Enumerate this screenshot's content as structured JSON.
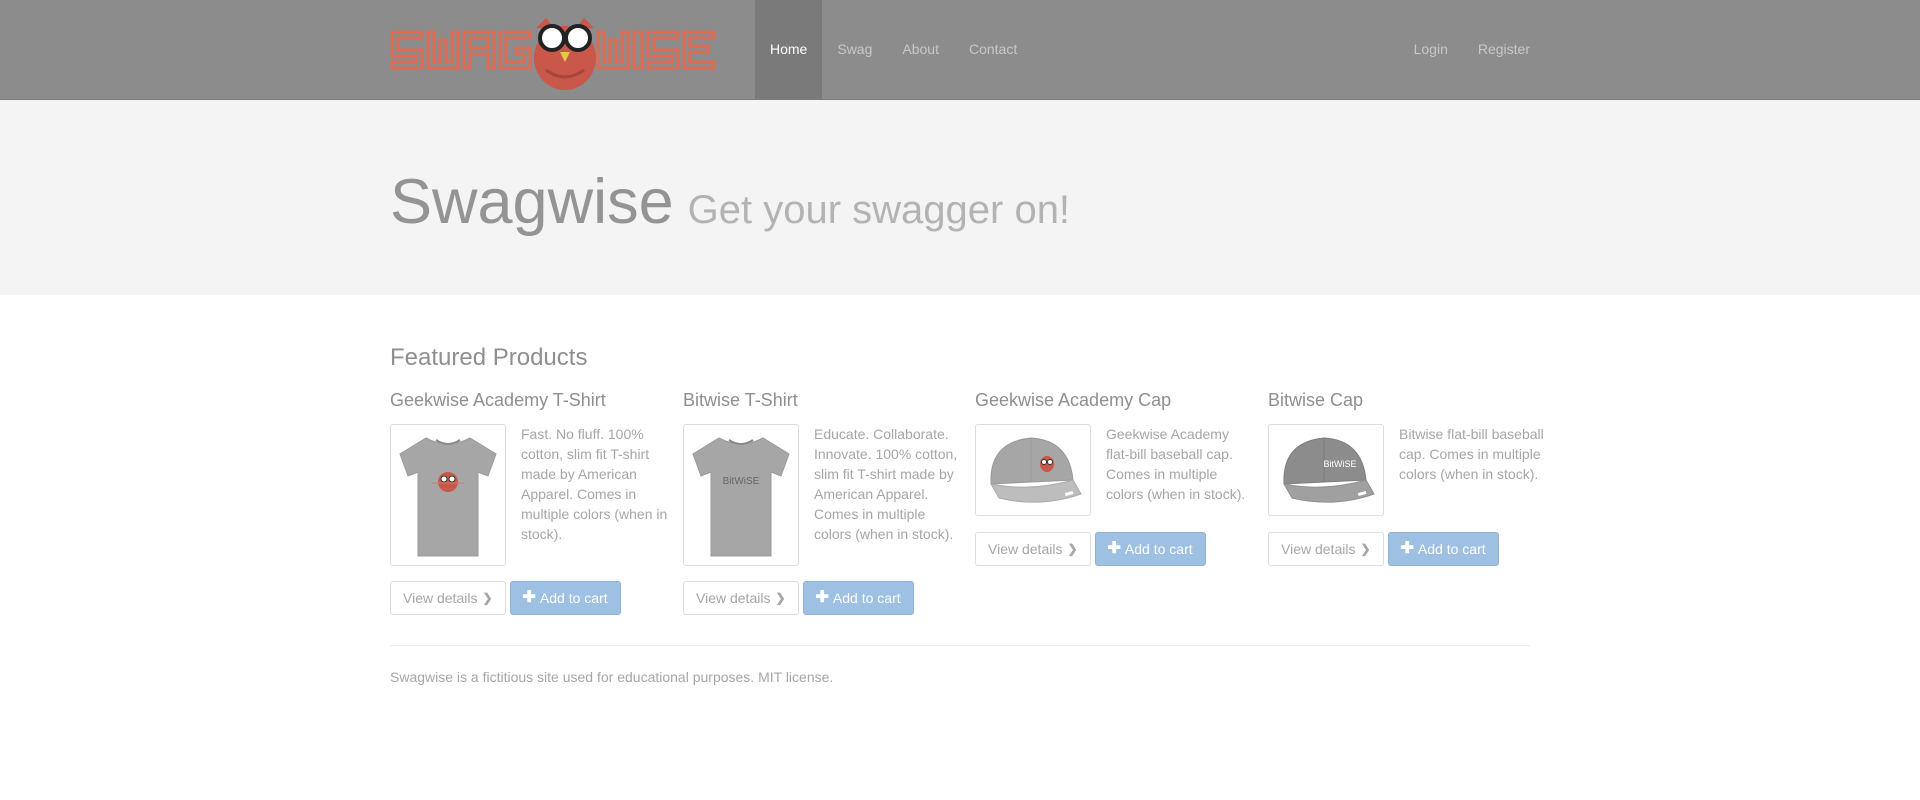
{
  "brand": {
    "name": "Swagwise",
    "logo_text": "SWAGWISE",
    "icon": "owl-logo-icon"
  },
  "nav": {
    "items": [
      {
        "label": "Home",
        "active": true
      },
      {
        "label": "Swag",
        "active": false
      },
      {
        "label": "About",
        "active": false
      },
      {
        "label": "Contact",
        "active": false
      }
    ],
    "right": [
      {
        "label": "Login"
      },
      {
        "label": "Register"
      }
    ]
  },
  "hero": {
    "title": "Swagwise",
    "tagline": "Get your swagger on!"
  },
  "featured": {
    "heading": "Featured Products",
    "products": [
      {
        "name": "Geekwise Academy T-Shirt",
        "description": "Fast. No fluff. 100% cotton, slim fit T-shirt made by American Apparel. Comes in multiple colors (when in stock).",
        "image_icon": "tshirt-owl-icon",
        "view_label": "View details",
        "cart_label": "Add to cart"
      },
      {
        "name": "Bitwise T-Shirt",
        "description": "Educate. Collaborate. Innovate. 100% cotton, slim fit T-shirt made by American Apparel. Comes in multiple colors (when in stock).",
        "image_icon": "tshirt-bitwise-icon",
        "image_text": "BitWiSE",
        "view_label": "View details",
        "cart_label": "Add to cart"
      },
      {
        "name": "Geekwise Academy Cap",
        "description": "Geekwise Academy flat-bill baseball cap. Comes in multiple colors (when in stock).",
        "image_icon": "cap-owl-icon",
        "view_label": "View details",
        "cart_label": "Add to cart"
      },
      {
        "name": "Bitwise Cap",
        "description": "Bitwise flat-bill baseball cap. Comes in multiple colors (when in stock).",
        "image_icon": "cap-bitwise-icon",
        "image_text": "BitWiSE",
        "view_label": "View details",
        "cart_label": "Add to cart"
      }
    ]
  },
  "footer": {
    "text": "Swagwise is a fictitious site used for educational purposes. MIT license."
  },
  "colors": {
    "navbar": "#8c8c8c",
    "logo": "#e06a52",
    "primary_button": "#9dc0e3",
    "jumbotron": "#f4f4f4"
  }
}
